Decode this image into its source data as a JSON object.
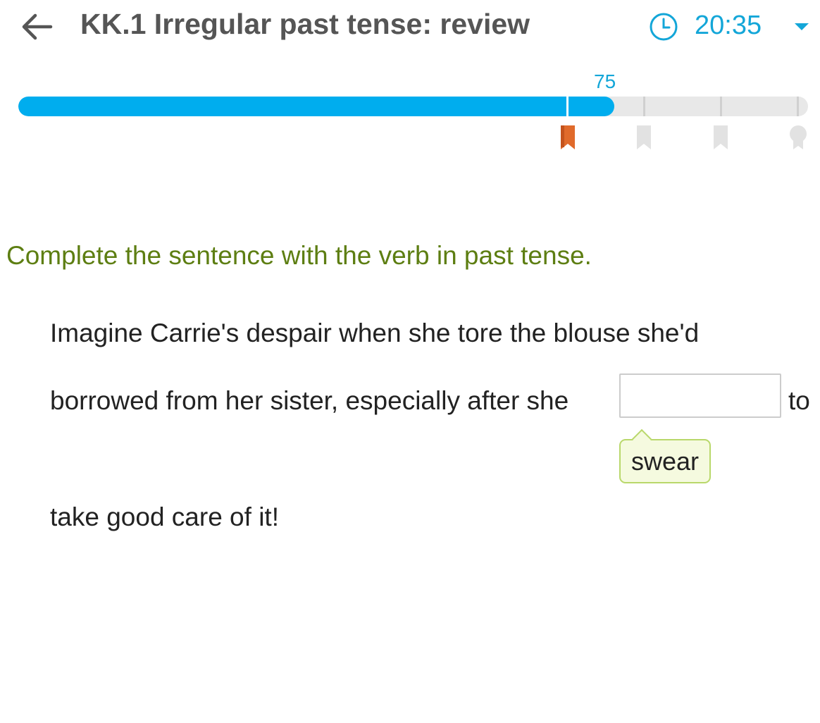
{
  "header": {
    "title": "KK.1 Irregular past tense: review",
    "timer": "20:35",
    "back_icon": "arrow-left-icon",
    "clock_icon": "clock-icon",
    "dropdown_icon": "chevron-down-icon"
  },
  "progress": {
    "value_label": "75",
    "fill_fraction": 0.755,
    "fill_color": "#00adee",
    "milestones": [
      "bookmark-icon",
      "bookmark-icon",
      "bookmark-icon",
      "award-ribbon-icon"
    ],
    "reached_milestone_color": "#e06a2b"
  },
  "question": {
    "instruction": "Complete the sentence with the verb in past tense.",
    "line1": "Imagine Carrie's despair when she tore the blouse she'd",
    "line2_before": "borrowed from her sister, especially after she",
    "line2_after": "to",
    "line3": "take good care of it!",
    "answer_value": "",
    "hint": "swear"
  },
  "colors": {
    "accent": "#13a6d8",
    "instruction": "#5d7e12",
    "hint_background": "#f5fadf",
    "hint_border": "#b9d86b"
  }
}
